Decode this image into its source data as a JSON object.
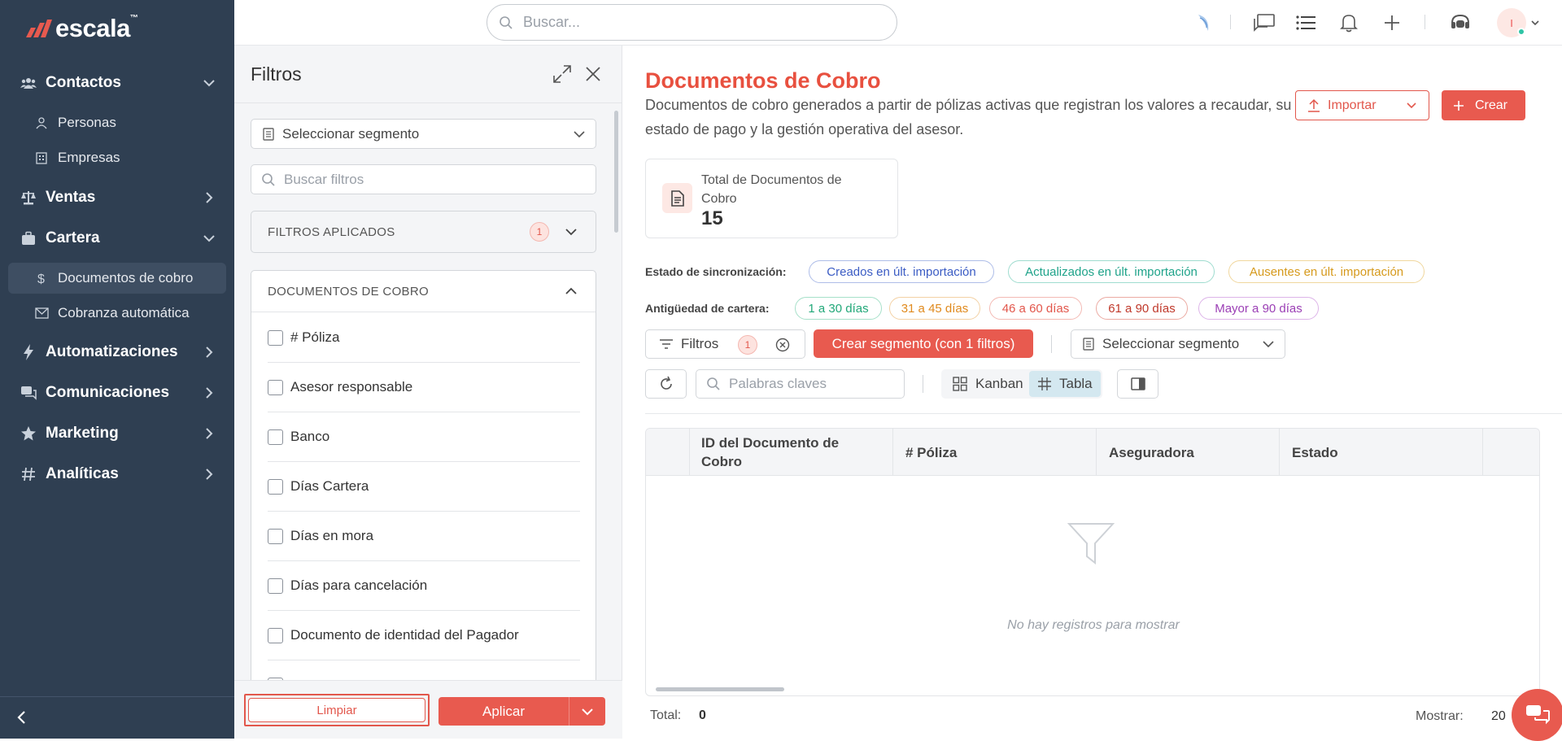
{
  "sidebar": {
    "logo": "escala",
    "logo_tm": "™",
    "sections": [
      {
        "label": "Contactos",
        "icon": "users-icon"
      },
      {
        "label": "Ventas",
        "icon": "scale-icon"
      },
      {
        "label": "Cartera",
        "icon": "briefcase-icon"
      },
      {
        "label": "Automatizaciones",
        "icon": "bolt-icon"
      },
      {
        "label": "Comunicaciones",
        "icon": "messages-icon"
      },
      {
        "label": "Marketing",
        "icon": "star-icon"
      },
      {
        "label": "Analíticas",
        "icon": "hash-icon"
      }
    ],
    "sub_items": [
      {
        "label": "Personas",
        "icon": "person-icon"
      },
      {
        "label": "Empresas",
        "icon": "building-icon"
      },
      {
        "label": "Documentos de cobro",
        "icon": "dollar-icon"
      },
      {
        "label": "Cobranza automática",
        "icon": "mail-icon"
      }
    ]
  },
  "topbar": {
    "search_placeholder": "Buscar...",
    "avatar_initial": "I"
  },
  "filters": {
    "title": "Filtros",
    "segment_placeholder": "Seleccionar segmento",
    "search_placeholder": "Buscar filtros",
    "applied_label": "FILTROS APLICADOS",
    "applied_count": "1",
    "section_label": "DOCUMENTOS DE COBRO",
    "fields": [
      "# Póliza",
      "Asesor responsable",
      "Banco",
      "Días Cartera",
      "Días en mora",
      "Días para cancelación",
      "Documento de identidad del Pagador"
    ],
    "clear_label": "Limpiar",
    "apply_label": "Aplicar"
  },
  "main": {
    "title": "Documentos de Cobro",
    "description": "Documentos de cobro generados a partir de pólizas activas que registran los valores a recaudar, su estado de pago y la gestión operativa del asesor.",
    "import_label": "Importar",
    "create_label": "Crear",
    "kpi_label": "Total de Documentos de Cobro",
    "kpi_value": "15",
    "sync_label": "Estado de sincronización:",
    "sync_chips": [
      "Creados en últ. importación",
      "Actualizados en últ. importación",
      "Ausentes en últ. importación"
    ],
    "age_label": "Antigüedad de cartera:",
    "age_chips": [
      "1 a 30 días",
      "31 a 45 días",
      "46 a 60 días",
      "61 a 90 días",
      "Mayor a 90 días"
    ],
    "filters_label": "Filtros",
    "filters_count": "1",
    "create_segment_label": "Crear segmento (con 1 filtros)",
    "segment_placeholder": "Seleccionar segmento",
    "keywords_placeholder": "Palabras claves",
    "view_kanban": "Kanban",
    "view_table": "Tabla",
    "columns": [
      "ID del Documento de Cobro",
      "# Póliza",
      "Aseguradora",
      "Estado"
    ],
    "empty_text": "No hay registros para mostrar",
    "total_label": "Total:",
    "total_value": "0",
    "show_label": "Mostrar:",
    "show_value": "20"
  },
  "colors": {
    "brand": "#e85a4f",
    "sidebar_bg": "#2f3f52",
    "chip_blue": "#3b5cc4",
    "chip_teal": "#1fa38a",
    "chip_yellow": "#d69a1d",
    "chip_green": "#22a879",
    "chip_orange": "#e08a1e",
    "chip_red": "#e2574c",
    "chip_darkred": "#c0392b",
    "chip_purple": "#9b3fb5"
  }
}
